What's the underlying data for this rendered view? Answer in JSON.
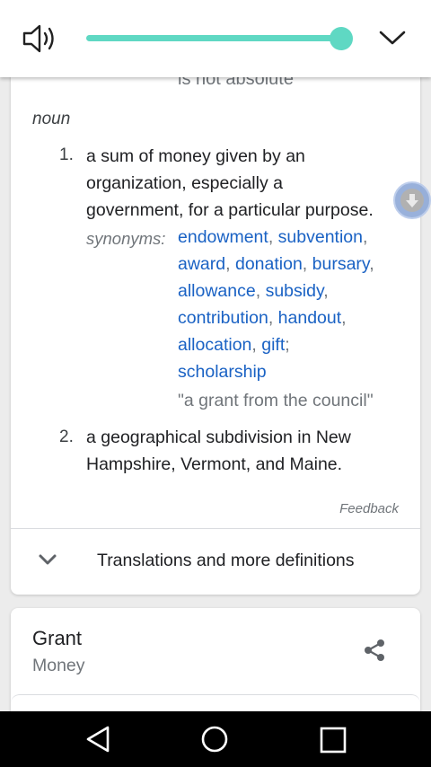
{
  "media": {
    "volume_level": 1.0,
    "accent_color": "#5fd8c3"
  },
  "definition": {
    "cut_off_text": "is not absolute",
    "part_of_speech": "noun",
    "senses": [
      {
        "number": "1.",
        "lines": [
          "a sum of money given by an",
          "organization, especially a",
          "government, for a particular purpose."
        ],
        "synonyms_label": "synonyms:",
        "synonyms": [
          "endowment",
          "subvention",
          "award",
          "donation",
          "bursary",
          "allowance",
          "subsidy",
          "contribution",
          "handout",
          "allocation",
          "gift",
          "scholarship"
        ],
        "example": "\"a grant from the council\""
      },
      {
        "number": "2.",
        "lines": [
          "a geographical subdivision in New",
          "Hampshire, Vermont, and Maine."
        ]
      }
    ],
    "feedback_label": "Feedback",
    "more_label": "Translations and more definitions"
  },
  "related_card": {
    "title": "Grant",
    "subtitle": "Money"
  },
  "colors": {
    "link": "#1a62c4",
    "muted": "#70757a"
  }
}
